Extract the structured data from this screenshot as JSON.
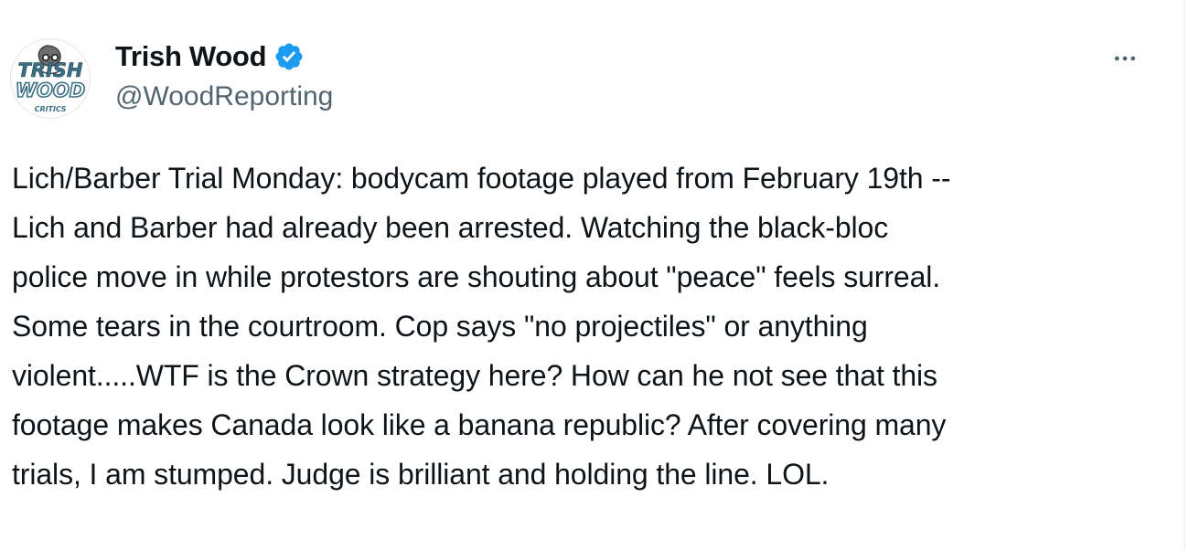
{
  "author": {
    "name": "Trish Wood",
    "handle": "@WoodReporting",
    "verified": true,
    "avatar": {
      "line1": "TRISH",
      "line2": "WOOD",
      "line3": "CRITICS"
    }
  },
  "more_menu": {
    "icon": "more-horizontal-icon"
  },
  "tweet": {
    "text": "Lich/Barber Trial Monday: bodycam footage played from February 19th --\nLich and Barber had already been arrested. Watching the black-bloc\npolice move in while protestors are shouting about \"peace\" feels surreal.\nSome tears in the courtroom. Cop says \"no projectiles\" or anything\nviolent.....WTF is the Crown strategy here? How can he not see that this\nfootage makes Canada look like a banana republic? After covering many\ntrials, I am stumped. Judge is brilliant and holding the line. LOL."
  },
  "colors": {
    "text": "#0f1419",
    "secondary": "#536471",
    "accent": "#1d9bf0",
    "border": "#eff3f4"
  }
}
